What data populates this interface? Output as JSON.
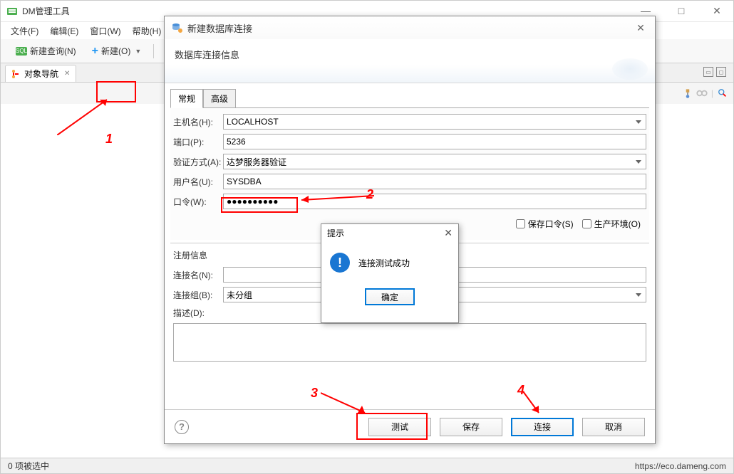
{
  "main": {
    "title": "DM管理工具",
    "menu": {
      "file": "文件(F)",
      "edit": "编辑(E)",
      "window": "窗口(W)",
      "help": "帮助(H)"
    },
    "toolbar": {
      "new_query": "新建查询(N)",
      "new": "新建(O)"
    },
    "nav_tab": "对象导航",
    "min_btn": "—",
    "max_btn": "□",
    "close_btn": "✕",
    "status_left": "0 项被选中",
    "status_right": "https://eco.dameng.com"
  },
  "dialog": {
    "title": "新建数据库连接",
    "subtitle": "数据库连接信息",
    "tabs": {
      "general": "常规",
      "advanced": "高级"
    },
    "labels": {
      "host": "主机名(H):",
      "port": "端口(P):",
      "auth": "验证方式(A):",
      "user": "用户名(U):",
      "password": "口令(W):",
      "save_pwd": "保存口令(S)",
      "prod_env": "生产环境(O)"
    },
    "values": {
      "host": "LOCALHOST",
      "port": "5236",
      "auth": "达梦服务器验证",
      "user": "SYSDBA",
      "password": "●●●●●●●●●●"
    },
    "regist": {
      "title": "注册信息",
      "conn_name": "连接名(N):",
      "conn_group": "连接组(B):",
      "desc": "描述(D):",
      "group_value": "未分组"
    },
    "buttons": {
      "test": "测试",
      "save": "保存",
      "connect": "连接",
      "cancel": "取消"
    },
    "help": "?"
  },
  "msgbox": {
    "title": "提示",
    "message": "连接测试成功",
    "ok": "确定"
  },
  "annotations": {
    "n1": "1",
    "n2": "2",
    "n3": "3",
    "n4": "4"
  }
}
